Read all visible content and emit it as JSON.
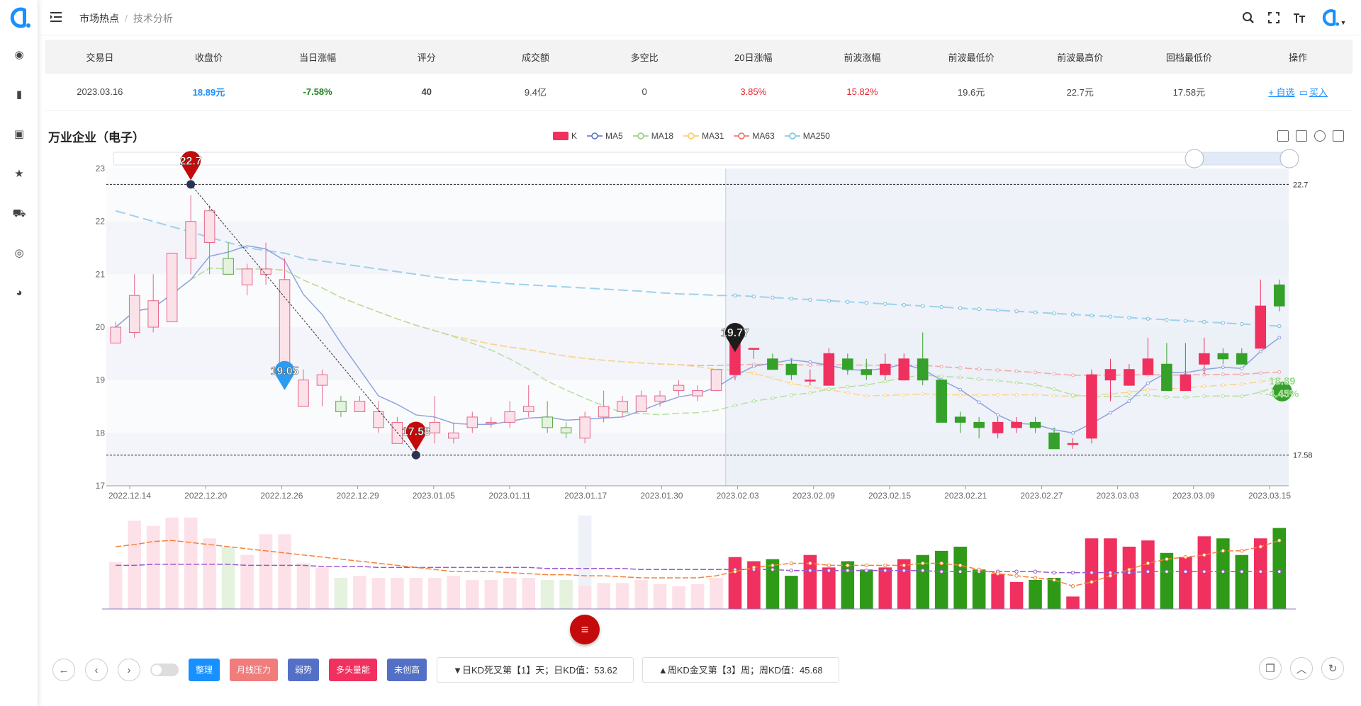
{
  "breadcrumb": {
    "item1": "市场热点",
    "separator": "/",
    "item2": "技术分析"
  },
  "table": {
    "headers": [
      "交易日",
      "收盘价",
      "当日涨幅",
      "评分",
      "成交额",
      "多空比",
      "20日涨幅",
      "前波涨幅",
      "前波最低价",
      "前波最高价",
      "回档最低价",
      "操作"
    ],
    "row": {
      "date": "2023.03.16",
      "close": "18.89元",
      "change": "-7.58%",
      "score": "40",
      "turnover": "9.4亿",
      "ratio": "0",
      "change20": "3.85%",
      "prev_wave": "15.82%",
      "prev_low": "19.6元",
      "prev_high": "22.7元",
      "pullback_low": "17.58元",
      "op_add": "+ 自选",
      "op_buy": "买入"
    }
  },
  "chart_title": "万业企业（电子）",
  "legend": [
    {
      "name": "K",
      "color": "#f0305e"
    },
    {
      "name": "MA5",
      "color": "#5470c6"
    },
    {
      "name": "MA18",
      "color": "#91cc75"
    },
    {
      "name": "MA31",
      "color": "#fac858"
    },
    {
      "name": "MA63",
      "color": "#ee6666"
    },
    {
      "name": "MA250",
      "color": "#73c0de"
    }
  ],
  "chart_data": {
    "type": "candlestick",
    "ylim": [
      17,
      23
    ],
    "y_ticks": [
      "17",
      "18",
      "19",
      "20",
      "21",
      "22",
      "23"
    ],
    "x_ticks": [
      "2022.12.14",
      "2022.12.20",
      "2022.12.26",
      "2022.12.29",
      "2023.01.05",
      "2023.01.11",
      "2023.01.17",
      "2023.01.30",
      "2023.02.03",
      "2023.02.09",
      "2023.02.15",
      "2023.02.21",
      "2023.02.27",
      "2023.03.03",
      "2023.03.09",
      "2023.03.15"
    ],
    "ohlc": [
      [
        19.7,
        20.0,
        19.9,
        20.1
      ],
      [
        19.9,
        20.6,
        19.8,
        21.0
      ],
      [
        20.0,
        20.5,
        19.9,
        21.0
      ],
      [
        20.1,
        21.4,
        20.1,
        21.4
      ],
      [
        21.3,
        22.0,
        21.0,
        22.5
      ],
      [
        21.6,
        22.2,
        21.0,
        22.3
      ],
      [
        21.3,
        21.0,
        21.0,
        21.6
      ],
      [
        20.8,
        21.1,
        20.6,
        21.2
      ],
      [
        21.0,
        21.1,
        20.8,
        21.6
      ],
      [
        19.0,
        20.9,
        19.0,
        21.3
      ],
      [
        18.5,
        19.0,
        18.5,
        19.2
      ],
      [
        18.9,
        19.1,
        18.5,
        19.2
      ],
      [
        18.6,
        18.4,
        18.3,
        18.7
      ],
      [
        18.4,
        18.6,
        18.4,
        18.7
      ],
      [
        18.1,
        18.4,
        18.0,
        18.6
      ],
      [
        17.8,
        18.2,
        17.8,
        18.3
      ],
      [
        17.9,
        18.1,
        17.6,
        18.2
      ],
      [
        18.0,
        18.2,
        17.8,
        18.7
      ],
      [
        17.9,
        18.0,
        17.8,
        18.2
      ],
      [
        18.1,
        18.3,
        18.0,
        18.4
      ],
      [
        18.2,
        18.2,
        18.1,
        18.3
      ],
      [
        18.2,
        18.4,
        18.1,
        18.6
      ],
      [
        18.4,
        18.5,
        18.3,
        18.9
      ],
      [
        18.3,
        18.1,
        18.0,
        18.6
      ],
      [
        18.1,
        18.0,
        17.9,
        18.2
      ],
      [
        17.9,
        18.3,
        17.8,
        18.4
      ],
      [
        18.3,
        18.5,
        18.2,
        18.8
      ],
      [
        18.4,
        18.6,
        18.3,
        18.7
      ],
      [
        18.4,
        18.7,
        18.4,
        18.8
      ],
      [
        18.6,
        18.7,
        18.5,
        18.8
      ],
      [
        18.8,
        18.9,
        18.7,
        19.0
      ],
      [
        18.7,
        18.8,
        18.6,
        18.9
      ],
      [
        18.8,
        19.2,
        18.8,
        19.2
      ],
      [
        19.1,
        19.8,
        19.0,
        19.8
      ],
      [
        19.6,
        19.6,
        19.4,
        19.6
      ],
      [
        19.4,
        19.2,
        19.2,
        19.5
      ],
      [
        19.3,
        19.1,
        19.0,
        19.4
      ],
      [
        19.0,
        19.0,
        18.9,
        19.2
      ],
      [
        18.9,
        19.5,
        18.9,
        19.6
      ],
      [
        19.4,
        19.2,
        19.1,
        19.5
      ],
      [
        19.2,
        19.1,
        19.0,
        19.4
      ],
      [
        19.1,
        19.3,
        19.0,
        19.5
      ],
      [
        19.0,
        19.4,
        19.0,
        19.5
      ],
      [
        19.4,
        19.0,
        18.9,
        19.9
      ],
      [
        19.0,
        18.2,
        18.2,
        19.0
      ],
      [
        18.3,
        18.2,
        18.0,
        18.4
      ],
      [
        18.2,
        18.1,
        17.9,
        18.3
      ],
      [
        18.0,
        18.2,
        17.9,
        18.3
      ],
      [
        18.1,
        18.2,
        18.0,
        18.3
      ],
      [
        18.2,
        18.1,
        18.0,
        18.3
      ],
      [
        18.0,
        17.7,
        17.7,
        18.1
      ],
      [
        17.8,
        17.8,
        17.7,
        17.9
      ],
      [
        17.9,
        19.1,
        17.8,
        19.2
      ],
      [
        19.0,
        19.2,
        18.6,
        19.4
      ],
      [
        18.9,
        19.2,
        18.9,
        19.3
      ],
      [
        19.1,
        19.4,
        19.1,
        19.8
      ],
      [
        19.3,
        18.8,
        18.8,
        19.7
      ],
      [
        18.8,
        19.1,
        18.8,
        19.7
      ],
      [
        19.3,
        19.5,
        19.1,
        19.8
      ],
      [
        19.5,
        19.4,
        19.3,
        19.6
      ],
      [
        19.5,
        19.3,
        19.3,
        19.6
      ],
      [
        19.6,
        20.4,
        19.6,
        20.9
      ],
      [
        20.8,
        20.4,
        20.3,
        20.9
      ]
    ],
    "annotations": {
      "high": "22.7",
      "low": "17.58",
      "mid_low": "19.05",
      "mid_high": "19.77",
      "last_close": "18.89",
      "last_change": "-4.45%"
    },
    "ref_lines": [
      "22.7",
      "17.58"
    ],
    "ma250": [
      22.2,
      22.1,
      22.0,
      21.9,
      21.8,
      21.7,
      21.6,
      21.5,
      21.45,
      21.4,
      21.3,
      21.25,
      21.2,
      21.15,
      21.1,
      21.05,
      21.0,
      20.95,
      20.9,
      20.88,
      20.85,
      20.82,
      20.8,
      20.78,
      20.76,
      20.74,
      20.72,
      20.7,
      20.68,
      20.65,
      20.63,
      20.62,
      20.6,
      20.6,
      20.58,
      20.56,
      20.54,
      20.52,
      20.5,
      20.48,
      20.46,
      20.44,
      20.42,
      20.4,
      20.38,
      20.36,
      20.34,
      20.32,
      20.3,
      20.28,
      20.26,
      20.24,
      20.22,
      20.2,
      20.18,
      20.16,
      20.14,
      20.12,
      20.1,
      20.08,
      20.06,
      20.04,
      20.02
    ],
    "volume": [
      0.45,
      0.85,
      0.8,
      0.88,
      0.88,
      0.68,
      0.6,
      0.52,
      0.72,
      0.72,
      0.44,
      0.4,
      0.3,
      0.32,
      0.3,
      0.3,
      0.3,
      0.3,
      0.32,
      0.28,
      0.28,
      0.3,
      0.3,
      0.28,
      0.28,
      0.22,
      0.25,
      0.25,
      0.28,
      0.24,
      0.22,
      0.24,
      0.3,
      0.5,
      0.46,
      0.48,
      0.32,
      0.52,
      0.4,
      0.46,
      0.38,
      0.4,
      0.48,
      0.52,
      0.56,
      0.6,
      0.38,
      0.34,
      0.26,
      0.28,
      0.3,
      0.12,
      0.68,
      0.68,
      0.6,
      0.66,
      0.54,
      0.5,
      0.7,
      0.68,
      0.52,
      0.68,
      0.78
    ],
    "vol_ma1": [
      0.6,
      0.62,
      0.65,
      0.66,
      0.64,
      0.62,
      0.6,
      0.58,
      0.56,
      0.54,
      0.52,
      0.5,
      0.48,
      0.46,
      0.44,
      0.42,
      0.4,
      0.38,
      0.36,
      0.36,
      0.36,
      0.35,
      0.34,
      0.33,
      0.33,
      0.32,
      0.32,
      0.31,
      0.3,
      0.3,
      0.3,
      0.3,
      0.32,
      0.36,
      0.4,
      0.42,
      0.44,
      0.44,
      0.42,
      0.42,
      0.42,
      0.42,
      0.42,
      0.44,
      0.44,
      0.42,
      0.38,
      0.34,
      0.32,
      0.3,
      0.28,
      0.22,
      0.26,
      0.32,
      0.38,
      0.44,
      0.48,
      0.5,
      0.52,
      0.56,
      0.56,
      0.6,
      0.66
    ],
    "vol_ma2": [
      0.42,
      0.42,
      0.43,
      0.43,
      0.43,
      0.43,
      0.43,
      0.42,
      0.42,
      0.42,
      0.42,
      0.41,
      0.41,
      0.41,
      0.4,
      0.4,
      0.4,
      0.4,
      0.4,
      0.4,
      0.4,
      0.4,
      0.4,
      0.39,
      0.39,
      0.39,
      0.39,
      0.39,
      0.38,
      0.38,
      0.38,
      0.38,
      0.38,
      0.38,
      0.38,
      0.38,
      0.37,
      0.37,
      0.37,
      0.37,
      0.37,
      0.37,
      0.37,
      0.37,
      0.36,
      0.36,
      0.36,
      0.36,
      0.36,
      0.36,
      0.35,
      0.35,
      0.35,
      0.35,
      0.35,
      0.36,
      0.36,
      0.36,
      0.36,
      0.36,
      0.36,
      0.36,
      0.36
    ]
  },
  "bottom": {
    "tags": [
      {
        "label": "整理",
        "color": "#1890ff"
      },
      {
        "label": "月线压力",
        "color": "#f07c7c"
      },
      {
        "label": "弱势",
        "color": "#5470c6"
      },
      {
        "label": "多头量能",
        "color": "#f0305e"
      },
      {
        "label": "未创高",
        "color": "#5470c6"
      }
    ],
    "info1": "▼日KD死叉第【1】天；日KD值：53.62",
    "info2": "▲周KD金叉第【3】周；周KD值：45.68"
  }
}
